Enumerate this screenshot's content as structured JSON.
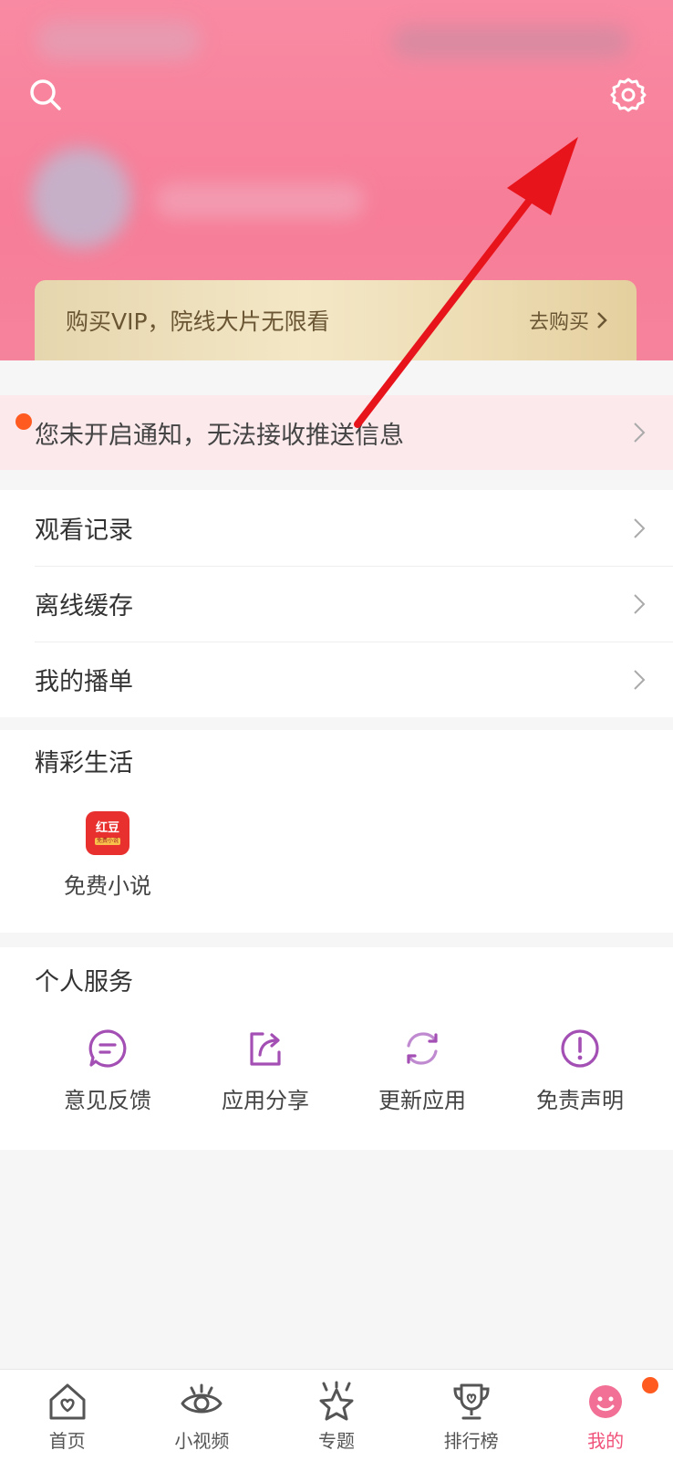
{
  "header": {
    "search_icon": "search-icon",
    "settings_icon": "gear-icon"
  },
  "vip": {
    "title": "购买VIP，院线大片无限看",
    "action": "去购买"
  },
  "notice": {
    "text": "您未开启通知，无法接收推送信息"
  },
  "menu": {
    "items": [
      {
        "label": "观看记录"
      },
      {
        "label": "离线缓存"
      },
      {
        "label": "我的播单"
      }
    ]
  },
  "life": {
    "title": "精彩生活",
    "apps": [
      {
        "label": "免费小说",
        "badge_text": "红豆",
        "badge_sub": "免费小说"
      }
    ]
  },
  "services": {
    "title": "个人服务",
    "items": [
      {
        "label": "意见反馈",
        "icon": "feedback-icon"
      },
      {
        "label": "应用分享",
        "icon": "share-icon"
      },
      {
        "label": "更新应用",
        "icon": "refresh-icon"
      },
      {
        "label": "免责声明",
        "icon": "info-icon"
      }
    ]
  },
  "nav": {
    "items": [
      {
        "label": "首页",
        "icon": "home-icon"
      },
      {
        "label": "小视频",
        "icon": "eye-icon"
      },
      {
        "label": "专题",
        "icon": "star-icon"
      },
      {
        "label": "排行榜",
        "icon": "trophy-icon"
      },
      {
        "label": "我的",
        "icon": "mine-icon"
      }
    ],
    "active_index": 4
  },
  "colors": {
    "header": "#f77d98",
    "accent": "#f0527a",
    "service_icon": "#a34fb4",
    "annotation_arrow": "#e8141c"
  }
}
